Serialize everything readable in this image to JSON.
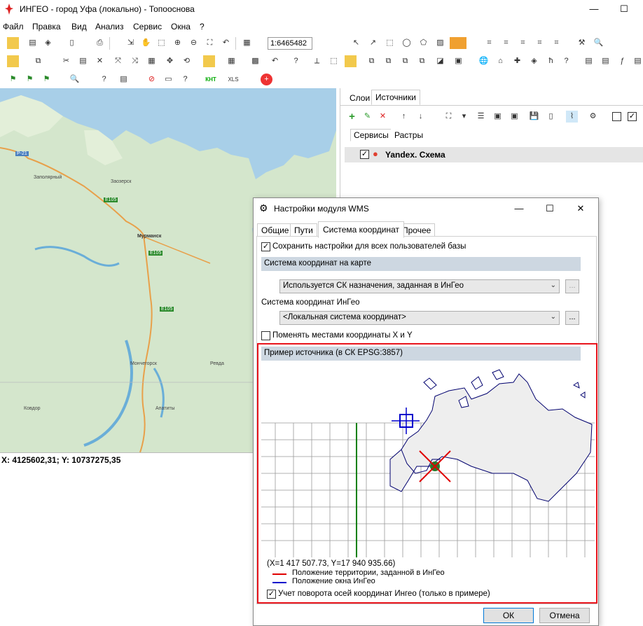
{
  "window": {
    "title": "ИНГЕО - город Уфа (локально) - Топооснова"
  },
  "menu": [
    "Файл",
    "Правка",
    "Вид",
    "Анализ",
    "Сервис",
    "Окна",
    "?"
  ],
  "toolbar": {
    "scale_value": "1:6465482",
    "xls_label": "XLS",
    "knt_label": "КНТ"
  },
  "map": {
    "labels": [
      "Р-21",
      "Заполярный",
      "Заозерск",
      "Е105",
      "Мурманск",
      "Е105",
      "Е105",
      "Мончегорск",
      "Ревда",
      "Ковдор",
      "Апатиты"
    ]
  },
  "status": {
    "coords": "X: 4125602,31; Y: 10737275,35"
  },
  "panel": {
    "tabs": [
      "Слои",
      "Источники"
    ],
    "subtabs": [
      "Сервисы",
      "Растры"
    ],
    "source_item": "Yandex. Схема"
  },
  "dialog": {
    "title": "Настройки модуля WMS",
    "tabs": [
      "Общие",
      "Пути",
      "Система координат",
      "Прочее"
    ],
    "save_all_users": "Сохранить настройки для всех пользователей базы",
    "map_cs_header": "Система координат на карте",
    "map_cs_combo": "Используется СК назначения, заданная в ИнГео",
    "ingeo_cs_label": "Система координат ИнГео",
    "ingeo_cs_combo": "<Локальная система координат>",
    "swap_xy": "Поменять местами координаты X и Y",
    "example_header": "Пример источника (в СК EPSG:3857)",
    "example_coords": "(X=1 417 507.73, Y=17 940 935.66)",
    "legend_red": "Положение территории, заданной в ИнГео",
    "legend_blue": "Положение окна ИнГео",
    "rotation": "Учет поворота осей координат Ингео (только в примере)",
    "ok": "ОК",
    "cancel": "Отмена",
    "dots": "...",
    "colors": {
      "red": "#e00000",
      "blue": "#0000cc",
      "green": "#008000",
      "highlight": "#e8141c"
    }
  }
}
